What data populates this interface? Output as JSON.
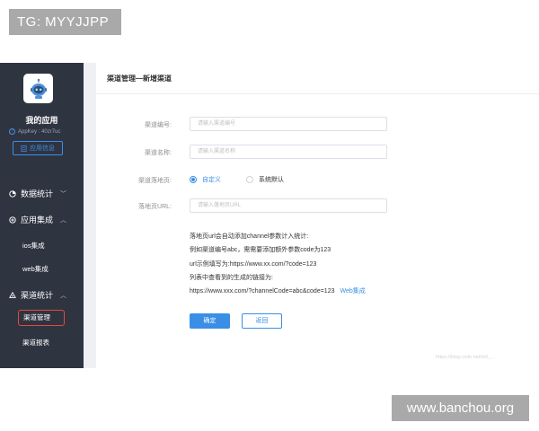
{
  "overlay": {
    "tg_badge": "TG: MYYJJPP",
    "site_badge": "www.banchou.org",
    "inner_watermark": "https://blog.csdn.net/m0_..."
  },
  "sidebar": {
    "app_name": "我的应用",
    "appkey": "AppKey : 40zr7uc",
    "app_info_button": "应用信息",
    "groups": [
      {
        "label": "数据统计",
        "icon": "pie-chart-icon",
        "chevron": "﹀"
      },
      {
        "label": "应用集成",
        "icon": "integration-icon",
        "chevron": "︿"
      },
      {
        "label": "渠道统计",
        "icon": "channel-icon",
        "chevron": "︿"
      }
    ],
    "subitems": [
      {
        "label": "ios集成"
      },
      {
        "label": "web集成"
      },
      {
        "label": "渠道管理",
        "active": true
      },
      {
        "label": "渠道报表"
      }
    ]
  },
  "main": {
    "page_title": "渠道管理—新增渠道",
    "fields": [
      {
        "label": "渠道编号:",
        "placeholder": "请输入渠道编号"
      },
      {
        "label": "渠道名称:",
        "placeholder": "请输入渠道名称"
      },
      {
        "label": "渠道落地页:"
      },
      {
        "label": "落地页URL:",
        "placeholder": "请输入落地页URL"
      }
    ],
    "radio_options": [
      "自定义",
      "系统默认"
    ],
    "help_lines": [
      "落地页url会自动添加channel参数计入统计:",
      "例如渠道编号abc，需需要添加额外参数code为123",
      "url示例填写为:https://www.xx.com/?code=123",
      "列表中查看到的生成的链接为:",
      "https://www.xxx.com/?channelCode=abc&code=123"
    ],
    "help_link": "Web集成",
    "confirm_button": "确定",
    "back_button": "返回"
  },
  "colors": {
    "accent": "#3a8ee6",
    "sidebar_bg": "#2f3441",
    "active_outline": "#e5483d"
  }
}
